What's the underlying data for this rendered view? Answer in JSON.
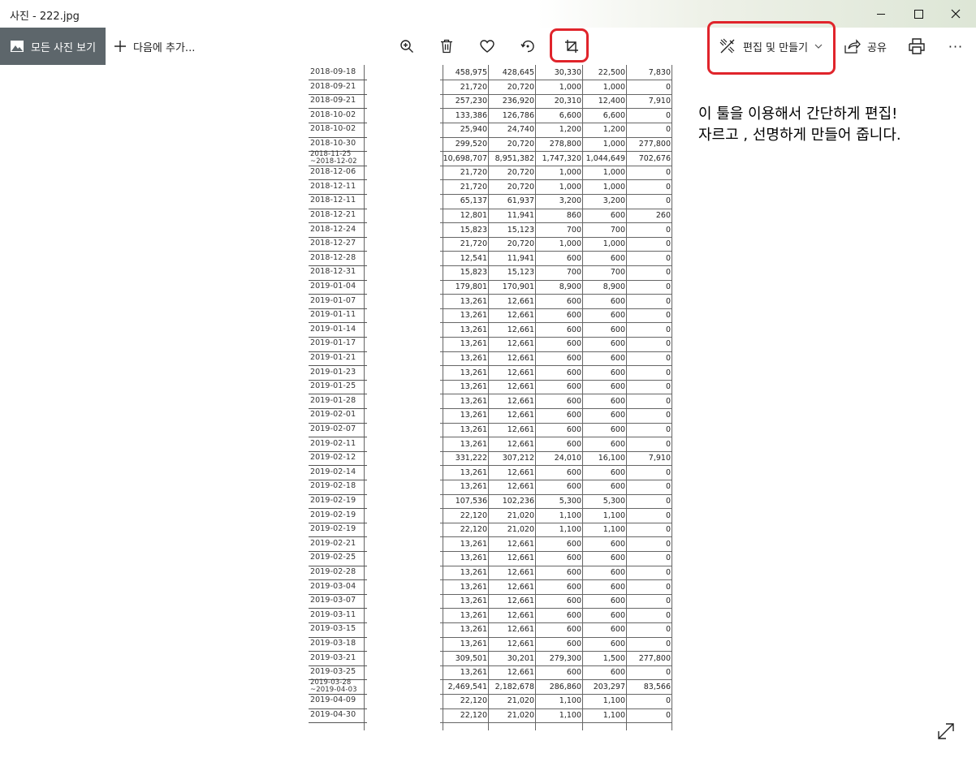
{
  "window": {
    "title": "사진 - 222.jpg",
    "minimize_glyph": "—",
    "maximize_glyph": "☐",
    "close_glyph": "✕"
  },
  "toolbar": {
    "all_photos_label": "모든 사진 보기",
    "add_to_label": "다음에 추가...",
    "add_glyph": "+",
    "edit_create_label": "편집 및 만들기",
    "share_label": "공유",
    "more_glyph": "···",
    "icons": [
      "zoom-in-icon",
      "delete-icon",
      "favorite-icon",
      "rotate-icon",
      "crop-icon",
      "edit-create-icon",
      "share-icon",
      "print-icon",
      "more-icon"
    ]
  },
  "annotation": {
    "line1": "이 툴을 이용해서 간단하게 편집!",
    "line2": "자르고 , 선명하게 만들어 줍니다."
  },
  "colors": {
    "highlight": "#e0242b",
    "sidebar_button": "#5d666b"
  },
  "document": {
    "dates": [
      "2018-09-18",
      "2018-09-21",
      "2018-09-21",
      "2018-10-02",
      "2018-10-02",
      "2018-10-30",
      "2018-11-25 ~2018-12-02",
      "2018-12-06",
      "2018-12-11",
      "2018-12-11",
      "2018-12-21",
      "2018-12-24",
      "2018-12-27",
      "2018-12-28",
      "2018-12-31",
      "2019-01-04",
      "2019-01-07",
      "2019-01-11",
      "2019-01-14",
      "2019-01-17",
      "2019-01-21",
      "2019-01-23",
      "2019-01-25",
      "2019-01-28",
      "2019-02-01",
      "2019-02-07",
      "2019-02-11",
      "2019-02-12",
      "2019-02-14",
      "2019-02-18",
      "2019-02-19",
      "2019-02-19",
      "2019-02-19",
      "2019-02-21",
      "2019-02-25",
      "2019-02-28",
      "2019-03-04",
      "2019-03-07",
      "2019-03-11",
      "2019-03-15",
      "2019-03-18",
      "2019-03-21",
      "2019-03-25",
      "2019-03-28 ~2019-04-03",
      "2019-04-09",
      "2019-04-30"
    ],
    "rows": [
      [
        "458,975",
        "428,645",
        "30,330",
        "22,500",
        "7,830"
      ],
      [
        "21,720",
        "20,720",
        "1,000",
        "1,000",
        "0"
      ],
      [
        "257,230",
        "236,920",
        "20,310",
        "12,400",
        "7,910"
      ],
      [
        "133,386",
        "126,786",
        "6,600",
        "6,600",
        "0"
      ],
      [
        "25,940",
        "24,740",
        "1,200",
        "1,200",
        "0"
      ],
      [
        "299,520",
        "20,720",
        "278,800",
        "1,000",
        "277,800"
      ],
      [
        "10,698,707",
        "8,951,382",
        "1,747,320",
        "1,044,649",
        "702,676"
      ],
      [
        "21,720",
        "20,720",
        "1,000",
        "1,000",
        "0"
      ],
      [
        "21,720",
        "20,720",
        "1,000",
        "1,000",
        "0"
      ],
      [
        "65,137",
        "61,937",
        "3,200",
        "3,200",
        "0"
      ],
      [
        "12,801",
        "11,941",
        "860",
        "600",
        "260"
      ],
      [
        "15,823",
        "15,123",
        "700",
        "700",
        "0"
      ],
      [
        "21,720",
        "20,720",
        "1,000",
        "1,000",
        "0"
      ],
      [
        "12,541",
        "11,941",
        "600",
        "600",
        "0"
      ],
      [
        "15,823",
        "15,123",
        "700",
        "700",
        "0"
      ],
      [
        "179,801",
        "170,901",
        "8,900",
        "8,900",
        "0"
      ],
      [
        "13,261",
        "12,661",
        "600",
        "600",
        "0"
      ],
      [
        "13,261",
        "12,661",
        "600",
        "600",
        "0"
      ],
      [
        "13,261",
        "12,661",
        "600",
        "600",
        "0"
      ],
      [
        "13,261",
        "12,661",
        "600",
        "600",
        "0"
      ],
      [
        "13,261",
        "12,661",
        "600",
        "600",
        "0"
      ],
      [
        "13,261",
        "12,661",
        "600",
        "600",
        "0"
      ],
      [
        "13,261",
        "12,661",
        "600",
        "600",
        "0"
      ],
      [
        "13,261",
        "12,661",
        "600",
        "600",
        "0"
      ],
      [
        "13,261",
        "12,661",
        "600",
        "600",
        "0"
      ],
      [
        "13,261",
        "12,661",
        "600",
        "600",
        "0"
      ],
      [
        "13,261",
        "12,661",
        "600",
        "600",
        "0"
      ],
      [
        "331,222",
        "307,212",
        "24,010",
        "16,100",
        "7,910"
      ],
      [
        "13,261",
        "12,661",
        "600",
        "600",
        "0"
      ],
      [
        "13,261",
        "12,661",
        "600",
        "600",
        "0"
      ],
      [
        "107,536",
        "102,236",
        "5,300",
        "5,300",
        "0"
      ],
      [
        "22,120",
        "21,020",
        "1,100",
        "1,100",
        "0"
      ],
      [
        "22,120",
        "21,020",
        "1,100",
        "1,100",
        "0"
      ],
      [
        "13,261",
        "12,661",
        "600",
        "600",
        "0"
      ],
      [
        "13,261",
        "12,661",
        "600",
        "600",
        "0"
      ],
      [
        "13,261",
        "12,661",
        "600",
        "600",
        "0"
      ],
      [
        "13,261",
        "12,661",
        "600",
        "600",
        "0"
      ],
      [
        "13,261",
        "12,661",
        "600",
        "600",
        "0"
      ],
      [
        "13,261",
        "12,661",
        "600",
        "600",
        "0"
      ],
      [
        "13,261",
        "12,661",
        "600",
        "600",
        "0"
      ],
      [
        "13,261",
        "12,661",
        "600",
        "600",
        "0"
      ],
      [
        "309,501",
        "30,201",
        "279,300",
        "1,500",
        "277,800"
      ],
      [
        "13,261",
        "12,661",
        "600",
        "600",
        "0"
      ],
      [
        "2,469,541",
        "2,182,678",
        "286,860",
        "203,297",
        "83,566"
      ],
      [
        "22,120",
        "21,020",
        "1,100",
        "1,100",
        "0"
      ],
      [
        "22,120",
        "21,020",
        "1,100",
        "1,100",
        "0"
      ]
    ]
  }
}
